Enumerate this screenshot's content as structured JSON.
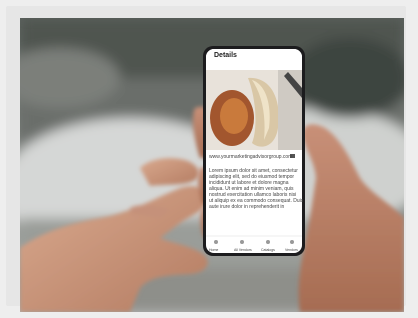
{
  "phone_screen": {
    "app_title": "Details",
    "email": "www.yourmarketingadvisorgroup.com",
    "paragraph_lines": [
      "Lorem ipsum dolor sit amet, consectetur",
      "adipiscing elit, sed do eiusmod tempor",
      "incididunt ut labore et dolore magna",
      "aliqua. Ut enim ad minim veniam, quis",
      "nostrud exercitation ullamco laboris nisi",
      "ut aliquip ex ea commodo consequat. Duis",
      "aute irure dolor in reprehenderit in"
    ],
    "bottom_nav": [
      "Home",
      "All Vendors",
      "Catalogs",
      "Vendors"
    ]
  }
}
